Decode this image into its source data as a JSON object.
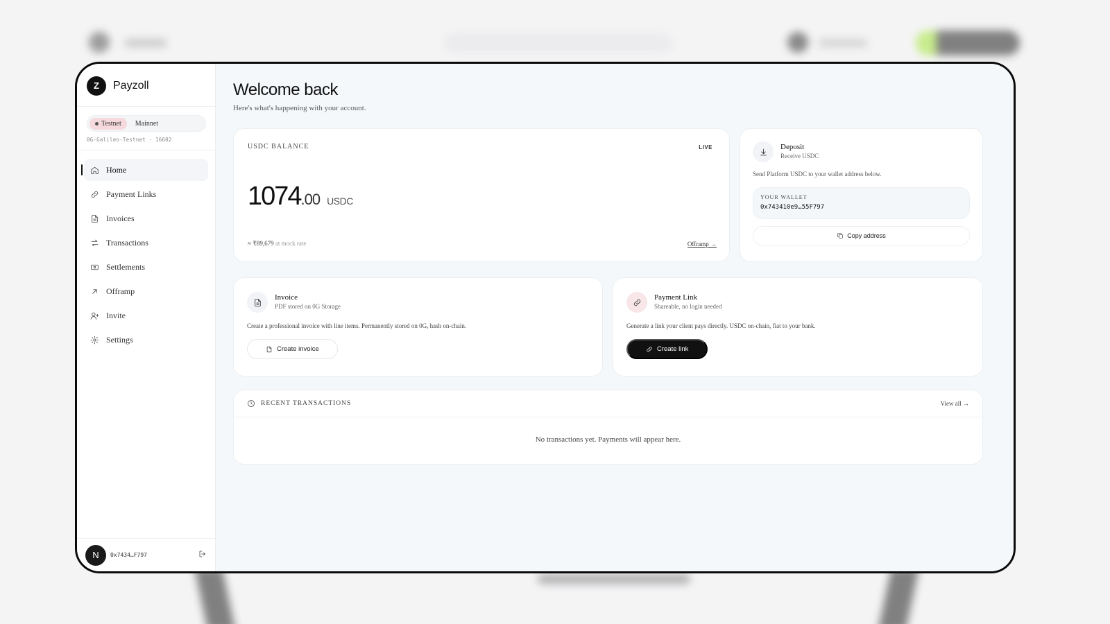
{
  "brand": {
    "logo_letter": "Z",
    "name": "Payzoll"
  },
  "network": {
    "options": [
      "Testnet",
      "Mainnet"
    ],
    "active": "Testnet",
    "chain_label": "0G-Galileo-Testnet · 16602"
  },
  "nav": {
    "items": [
      {
        "label": "Home",
        "icon": "home-icon",
        "active": true
      },
      {
        "label": "Payment Links",
        "icon": "link-icon"
      },
      {
        "label": "Invoices",
        "icon": "document-icon"
      },
      {
        "label": "Transactions",
        "icon": "arrows-swap-icon"
      },
      {
        "label": "Settlements",
        "icon": "cash-icon"
      },
      {
        "label": "Offramp",
        "icon": "arrow-up-right-icon"
      },
      {
        "label": "Invite",
        "icon": "user-plus-icon"
      },
      {
        "label": "Settings",
        "icon": "gear-icon"
      }
    ]
  },
  "footer": {
    "avatar_letter": "N",
    "address": "0x7434…F797"
  },
  "header": {
    "title": "Welcome back",
    "subtitle": "Here's what's happening with your account."
  },
  "balance": {
    "label": "USDC BALANCE",
    "status": "LIVE",
    "integer": "1074",
    "decimal": ".00",
    "unit": "USDC",
    "fiat_value": "≈ ₹89,679",
    "fiat_note": "at mock rate",
    "offramp_link": "Offramp →"
  },
  "deposit": {
    "title": "Deposit",
    "subtitle": "Receive USDC",
    "description": "Send Platform USDC to your wallet address below.",
    "wallet_label": "YOUR WALLET",
    "wallet_address": "0x743410e9…55F797",
    "copy_label": "Copy address"
  },
  "invoice": {
    "title": "Invoice",
    "subtitle": "PDF stored on 0G Storage",
    "description": "Create a professional invoice with line items. Permanently stored on 0G, hash on-chain.",
    "button": "Create invoice"
  },
  "payment_link": {
    "title": "Payment Link",
    "subtitle": "Shareable, no login needed",
    "description": "Generate a link your client pays directly. USDC on-chain, fiat to your bank.",
    "button": "Create link"
  },
  "transactions": {
    "title": "RECENT TRANSACTIONS",
    "view_all": "View all →",
    "empty": "No transactions yet. Payments will appear here."
  },
  "colors": {
    "accent_dark": "#111111",
    "testnet_pill": "#f5d9dc",
    "main_bg": "#f5f8fb"
  }
}
